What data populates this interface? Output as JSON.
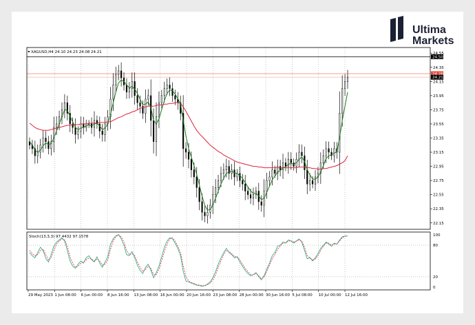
{
  "brand": {
    "line1": "Ultima",
    "line2": "Markets"
  },
  "chart_data": [
    {
      "type": "candlestick",
      "symbol_header": "XAGUSD,H4  24.10 24.23 24.08 24.21",
      "y_ticks": [
        "24.55",
        "24.35",
        "24.15",
        "23.95",
        "23.75",
        "23.55",
        "23.35",
        "23.15",
        "22.95",
        "22.75",
        "22.55",
        "22.35",
        "22.15"
      ],
      "y_tick_values": [
        24.55,
        24.35,
        24.15,
        23.95,
        23.75,
        23.55,
        23.35,
        23.15,
        22.95,
        22.75,
        22.55,
        22.35,
        22.15
      ],
      "ylim": [
        22.06,
        24.63
      ],
      "x_ticks": [
        "29 May 2023",
        "1 Jun 08:00",
        "6 Jun 00:00",
        "8 Jun 16:00",
        "13 Jun 08:00",
        "16 Jun 00:00",
        "20 Jun 16:00",
        "23 Jun 08:00",
        "28 Jun 00:00",
        "30 Jun 16:00",
        "5 Jul 08:00",
        "10 Jul 00:00",
        "12 Jul 16:00"
      ],
      "level_labels": [
        {
          "text": "24.50",
          "value": 24.5,
          "color": "#000000"
        },
        {
          "text": "24.26",
          "value": 24.26,
          "color": "#e04a3a"
        },
        {
          "text": "24.21",
          "value": 24.21,
          "color": "#000000"
        }
      ],
      "horizontal_levels": [
        {
          "value": 24.5,
          "color": "#000000"
        },
        {
          "value": 24.26,
          "color": "#e8836f"
        },
        {
          "value": 24.21,
          "color": "#f2b8ab"
        }
      ],
      "series": [
        {
          "type": "candlestick",
          "close": [
            23.25,
            23.2,
            23.1,
            23.15,
            23.25,
            23.35,
            23.3,
            23.2,
            23.3,
            23.5,
            23.55,
            23.65,
            23.75,
            23.85,
            23.7,
            23.55,
            23.5,
            23.4,
            23.45,
            23.55,
            23.5,
            23.55,
            23.55,
            23.5,
            23.6,
            23.55,
            23.45,
            23.4,
            23.55,
            23.65,
            23.9,
            24.1,
            24.25,
            24.3,
            24.2,
            24.1,
            24.0,
            24.05,
            24.15,
            23.95,
            23.85,
            23.8,
            23.7,
            23.9,
            23.95,
            23.6,
            23.3,
            23.65,
            23.85,
            23.95,
            24.05,
            24.1,
            24.05,
            23.95,
            23.9,
            23.85,
            23.7,
            23.2,
            23.15,
            23.05,
            22.9,
            22.8,
            22.65,
            22.45,
            22.3,
            22.25,
            22.3,
            22.4,
            22.55,
            22.65,
            22.75,
            22.85,
            22.9,
            22.95,
            22.85,
            22.9,
            22.8,
            22.85,
            22.75,
            22.7,
            22.6,
            22.55,
            22.5,
            22.55,
            22.6,
            22.45,
            22.4,
            22.6,
            22.75,
            22.8,
            22.9,
            22.85,
            22.95,
            22.9,
            23.0,
            22.95,
            23.05,
            23.0,
            22.95,
            23.05,
            23.15,
            23.1,
            22.9,
            22.7,
            22.75,
            22.7,
            22.8,
            22.85,
            23.0,
            23.1,
            23.2,
            23.15,
            23.1,
            23.2,
            23.15,
            23.7,
            24.05,
            24.15,
            24.21
          ],
          "color_up": "#000000",
          "color_down": "#000000"
        },
        {
          "name": "",
          "type": "line",
          "color": "#e0203c",
          "values": [
            23.56,
            23.53,
            23.5,
            23.48,
            23.47,
            23.46,
            23.46,
            23.46,
            23.47,
            23.48,
            23.49,
            23.5,
            23.51,
            23.52,
            23.53,
            23.53,
            23.54,
            23.54,
            23.54,
            23.55,
            23.55,
            23.55,
            23.56,
            23.56,
            23.56,
            23.56,
            23.57,
            23.57,
            23.57,
            23.58,
            23.58,
            23.6,
            23.62,
            23.64,
            23.65,
            23.67,
            23.69,
            23.7,
            23.72,
            23.73,
            23.75,
            23.77,
            23.78,
            23.79,
            23.8,
            23.8,
            23.8,
            23.81,
            23.82,
            23.82,
            23.83,
            23.83,
            23.84,
            23.84,
            23.85,
            23.85,
            23.84,
            23.79,
            23.73,
            23.66,
            23.59,
            23.52,
            23.46,
            23.41,
            23.37,
            23.33,
            23.29,
            23.25,
            23.22,
            23.19,
            23.16,
            23.14,
            23.11,
            23.09,
            23.07,
            23.05,
            23.03,
            23.01,
            23.0,
            22.99,
            22.98,
            22.97,
            22.96,
            22.95,
            22.95,
            22.94,
            22.94,
            22.93,
            22.93,
            22.93,
            22.93,
            22.93,
            22.93,
            22.93,
            22.93,
            22.93,
            22.93,
            22.93,
            22.93,
            22.93,
            22.94,
            22.94,
            22.94,
            22.93,
            22.93,
            22.92,
            22.92,
            22.91,
            22.91,
            22.92,
            22.92,
            22.93,
            22.94,
            22.95,
            22.96,
            22.98,
            23.0,
            23.03,
            23.1
          ]
        },
        {
          "name": "",
          "type": "line",
          "color": "#1a7a1a",
          "values": [
            23.3,
            23.25,
            23.18,
            23.15,
            23.18,
            23.24,
            23.28,
            23.26,
            23.27,
            23.35,
            23.45,
            23.55,
            23.65,
            23.75,
            23.74,
            23.66,
            23.58,
            23.5,
            23.47,
            23.49,
            23.5,
            23.52,
            23.54,
            23.52,
            23.55,
            23.56,
            23.52,
            23.47,
            23.49,
            23.55,
            23.68,
            23.85,
            24.0,
            24.13,
            24.17,
            24.15,
            24.1,
            24.06,
            24.08,
            24.04,
            23.98,
            23.9,
            23.82,
            23.83,
            23.86,
            23.78,
            23.6,
            23.55,
            23.62,
            23.75,
            23.88,
            23.98,
            24.03,
            24.02,
            23.97,
            23.91,
            23.83,
            23.6,
            23.38,
            23.2,
            23.08,
            22.96,
            22.84,
            22.68,
            22.53,
            22.4,
            22.33,
            22.34,
            22.4,
            22.5,
            22.6,
            22.7,
            22.78,
            22.85,
            22.87,
            22.88,
            22.86,
            22.85,
            22.82,
            22.78,
            22.72,
            22.66,
            22.6,
            22.57,
            22.57,
            22.53,
            22.48,
            22.5,
            22.58,
            22.67,
            22.76,
            22.81,
            22.87,
            22.89,
            22.93,
            22.94,
            22.98,
            22.99,
            22.98,
            23.0,
            23.05,
            23.08,
            23.02,
            22.9,
            22.83,
            22.77,
            22.77,
            22.8,
            22.87,
            22.96,
            23.06,
            23.1,
            23.11,
            23.14,
            23.15,
            23.35,
            23.6,
            23.8,
            24.0
          ]
        }
      ]
    },
    {
      "type": "line",
      "indicator_header": "Stoch(13,3,3) 97.4432 97.1578",
      "y_ticks": [
        "100",
        "80",
        "20",
        "0"
      ],
      "y_tick_values": [
        100,
        80,
        20,
        0
      ],
      "ylim": [
        -5,
        105
      ],
      "levels": [
        80,
        20
      ],
      "series": [
        {
          "name": "",
          "color": "#1aa87a",
          "values": [
            66,
            60,
            56,
            66,
            76,
            70,
            55,
            48,
            62,
            78,
            86,
            90,
            94,
            88,
            70,
            50,
            40,
            36,
            44,
            50,
            46,
            56,
            60,
            52,
            48,
            58,
            46,
            38,
            48,
            58,
            82,
            92,
            98,
            100,
            92,
            80,
            62,
            60,
            68,
            56,
            42,
            32,
            26,
            38,
            44,
            32,
            18,
            28,
            40,
            58,
            76,
            88,
            94,
            92,
            84,
            74,
            60,
            30,
            12,
            10,
            8,
            6,
            4,
            3,
            2,
            3,
            6,
            10,
            18,
            30,
            44,
            56,
            66,
            74,
            66,
            62,
            56,
            58,
            48,
            40,
            32,
            26,
            22,
            24,
            28,
            20,
            14,
            22,
            34,
            46,
            60,
            66,
            78,
            80,
            86,
            84,
            90,
            88,
            84,
            88,
            92,
            86,
            70,
            54,
            56,
            50,
            56,
            64,
            74,
            80,
            86,
            82,
            78,
            84,
            82,
            90,
            96,
            97.4,
            97.4
          ]
        },
        {
          "name": "",
          "color": "#e0203c",
          "values": [
            70,
            64,
            60,
            62,
            70,
            72,
            62,
            52,
            56,
            70,
            82,
            88,
            92,
            90,
            78,
            58,
            46,
            38,
            40,
            46,
            48,
            52,
            56,
            54,
            50,
            54,
            50,
            42,
            44,
            52,
            72,
            88,
            96,
            100,
            96,
            86,
            70,
            62,
            64,
            60,
            48,
            38,
            30,
            34,
            40,
            36,
            24,
            24,
            34,
            50,
            68,
            82,
            92,
            94,
            88,
            78,
            66,
            40,
            20,
            12,
            9,
            7,
            5,
            4,
            3,
            3,
            5,
            8,
            14,
            24,
            38,
            50,
            62,
            70,
            68,
            64,
            58,
            58,
            52,
            44,
            36,
            30,
            24,
            24,
            26,
            22,
            16,
            20,
            30,
            42,
            54,
            62,
            72,
            78,
            84,
            84,
            88,
            88,
            86,
            88,
            90,
            88,
            76,
            60,
            56,
            52,
            54,
            60,
            70,
            78,
            84,
            84,
            80,
            82,
            82,
            88,
            94,
            97.1,
            97.2
          ]
        }
      ]
    }
  ]
}
